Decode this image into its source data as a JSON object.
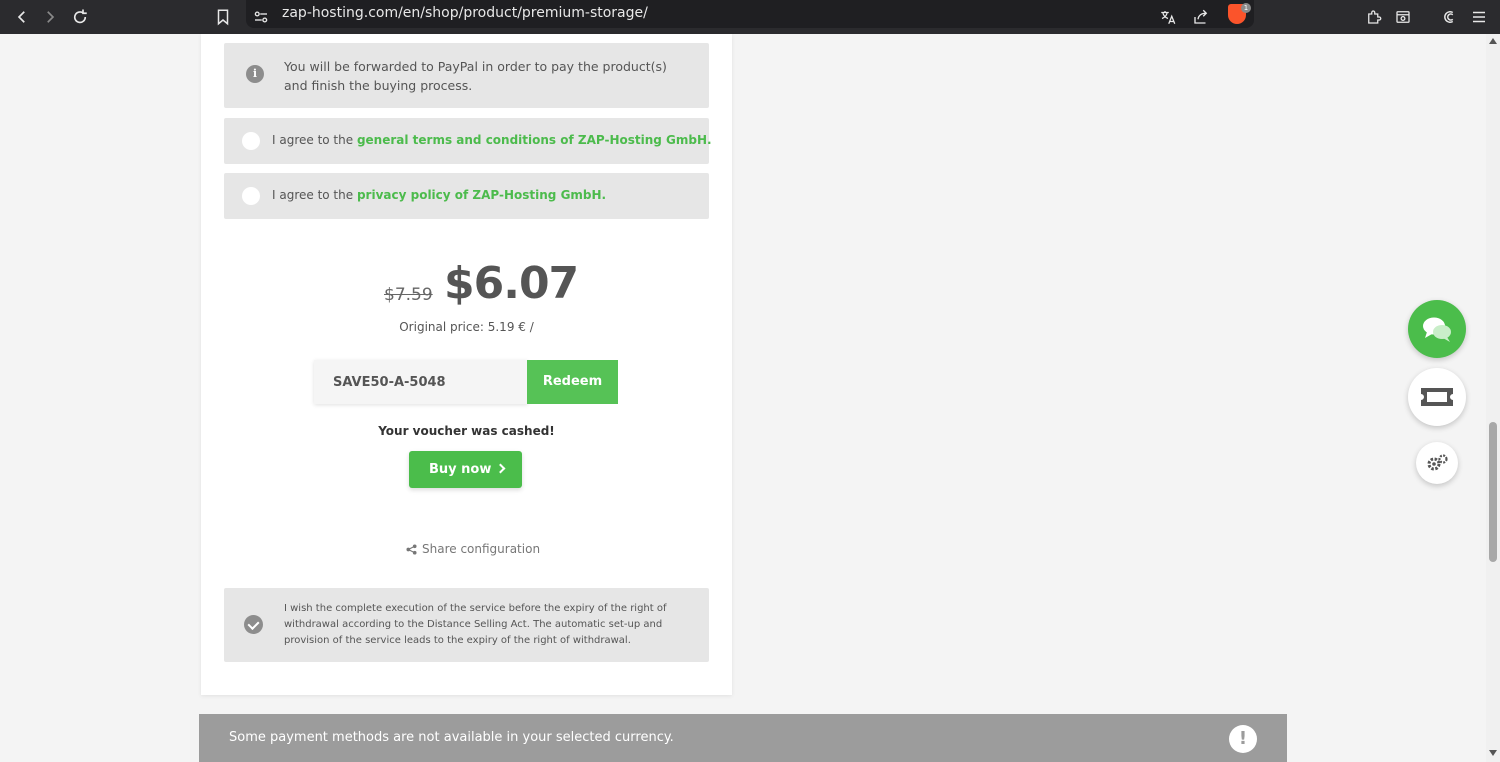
{
  "browser": {
    "url": "zap-hosting.com/en/shop/product/premium-storage/",
    "brave_badge": "1"
  },
  "checkout": {
    "paypal_notice": "You will be forwarded to PayPal in order to pay the product(s) and finish the buying process.",
    "terms_prefix": "I agree to the ",
    "terms_link": "general terms and conditions of ZAP-Hosting GmbH.",
    "privacy_prefix": "I agree to the ",
    "privacy_link": "privacy policy of ZAP-Hosting GmbH.",
    "old_price": "$7.59",
    "new_price": "$6.07",
    "original_price": "Original price: 5.19 € /",
    "voucher_code": "SAVE50-A-5048",
    "redeem_label": "Redeem",
    "voucher_status": "Your voucher was cashed!",
    "buy_now_label": "Buy now",
    "share_label": "Share configuration",
    "withdrawal_text": "I wish the complete execution of the service before the expiry of the right of withdrawal according to the Distance Selling Act. The automatic set-up and provision of the service leads to the expiry of the right of withdrawal."
  },
  "notice": {
    "text": "Some payment methods are not available in your selected currency.",
    "icon": "!"
  },
  "colors": {
    "accent_green": "#4bbd4b",
    "link_green": "#4cbb4c",
    "toolbar": "#2b2b2e"
  }
}
